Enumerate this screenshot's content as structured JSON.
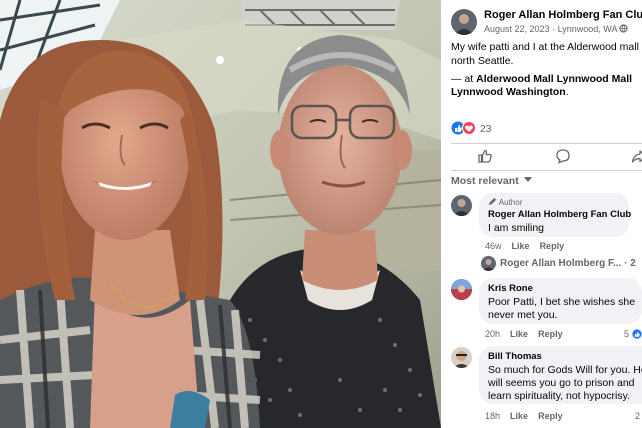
{
  "post": {
    "page_name": "Roger Allan Holmberg Fan Club",
    "date": "August 22, 2023",
    "location": "Lynnwood, WA",
    "text_line1": "My wife patti and I at the Alderwood mall",
    "text_line2": "north Seattle.",
    "at_prefix": "— at",
    "place_line1": "Alderwood Mall Lynnwood Mall",
    "place_line2": "Lynnwood Washington",
    "place_suffix": ".",
    "reaction_count": "23"
  },
  "actions": {
    "like_icon": "thumbs-up-icon",
    "comment_icon": "comment-icon",
    "share_icon": "share-icon"
  },
  "sort": {
    "label": "Most relevant"
  },
  "comments": [
    {
      "author_badge": "Author",
      "author": "Roger Allan Holmberg Fan Club",
      "text": "I am smiling",
      "time": "46w",
      "like": "Like",
      "reply": "Reply"
    },
    {
      "author": "Kris Rone",
      "text_line1": "Poor Patti, I bet she wishes she",
      "text_line2": "never met you.",
      "time": "20h",
      "like": "Like",
      "reply": "Reply",
      "count": "5"
    },
    {
      "author": "Bill Thomas",
      "text_line1": "So much for Gods Will for you. He",
      "text_line2": "will seems you go to prison and",
      "text_line3": "learn spirituality, not hypocrisy.",
      "time": "18h",
      "like": "Like",
      "reply": "Reply",
      "count": "2"
    }
  ],
  "reply_preview": {
    "author": "Roger Allan Holmberg F...",
    "count": "2"
  },
  "colors": {
    "link_blue": "#1877f2",
    "bubble": "#f0f2f5",
    "muted": "#65676b"
  }
}
